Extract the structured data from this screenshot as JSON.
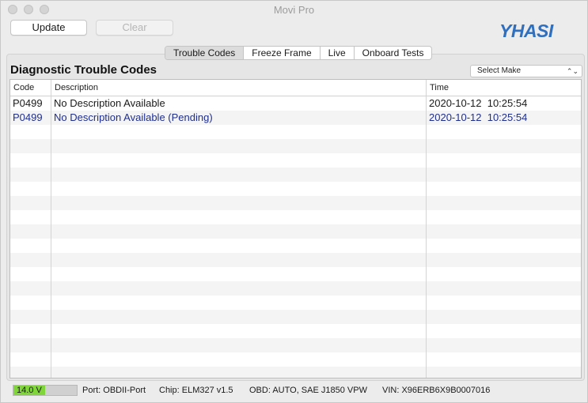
{
  "window": {
    "title": "Movi Pro"
  },
  "toolbar": {
    "update_label": "Update",
    "clear_label": "Clear"
  },
  "logo": {
    "text": "YHASI"
  },
  "tabs": [
    {
      "label": "Trouble Codes",
      "active": true
    },
    {
      "label": "Freeze Frame",
      "active": false
    },
    {
      "label": "Live",
      "active": false
    },
    {
      "label": "Onboard Tests",
      "active": false
    }
  ],
  "main": {
    "heading": "Diagnostic Trouble Codes",
    "select_make": {
      "value": "Select Make"
    },
    "table": {
      "columns": [
        "Code",
        "Description",
        "Time"
      ],
      "rows": [
        {
          "code": "P0499",
          "description": "No Description Available",
          "time": "2020-10-12  10:25:54"
        },
        {
          "code": "P0499",
          "description": "No Description Available (Pending)",
          "time": "2020-10-12  10:25:54"
        }
      ]
    }
  },
  "status": {
    "voltage": "14.0 V",
    "voltage_fill_fraction": 0.5,
    "port": "Port: OBDII-Port",
    "chip": "Chip: ELM327 v1.5",
    "obd": "OBD: AUTO, SAE J1850 VPW",
    "vin": "VIN: X96ERB6X9B0007016"
  },
  "colors": {
    "pending_text": "#1f2f8f",
    "voltage_fill": "#7fd53a",
    "logo_blue": "#2f6fbf"
  }
}
